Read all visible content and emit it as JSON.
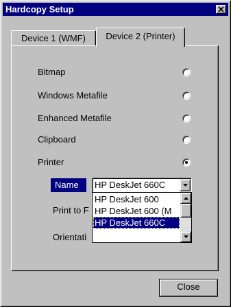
{
  "window": {
    "title": "Hardcopy Setup"
  },
  "tabs": [
    {
      "label": "Device 1 (WMF)",
      "active": false
    },
    {
      "label": "Device 2 (Printer)",
      "active": true
    }
  ],
  "output_options": [
    {
      "label": "Bitmap",
      "selected": false
    },
    {
      "label": "Windows Metafile",
      "selected": false
    },
    {
      "label": "Enhanced Metafile",
      "selected": false
    },
    {
      "label": "Clipboard",
      "selected": false
    },
    {
      "label": "Printer",
      "selected": true
    }
  ],
  "printer": {
    "name_label": "Name",
    "name_value": "HP DeskJet 660C",
    "print_to_file_label": "Print to F",
    "orientation_label": "Orientati",
    "dropdown_options": [
      "HP DeskJet 600",
      "HP DeskJet 600 (M",
      "HP DeskJet 660C"
    ],
    "dropdown_selected_index": 2
  },
  "buttons": {
    "close": "Close"
  },
  "icons": {
    "close": "close-x-icon",
    "dropdown_arrow": "chevron-down-icon",
    "scroll_up": "arrow-up-icon",
    "scroll_down": "arrow-down-icon"
  },
  "colors": {
    "titlebar": "#000080",
    "face": "#c0c0c0",
    "highlight": "#000080"
  }
}
